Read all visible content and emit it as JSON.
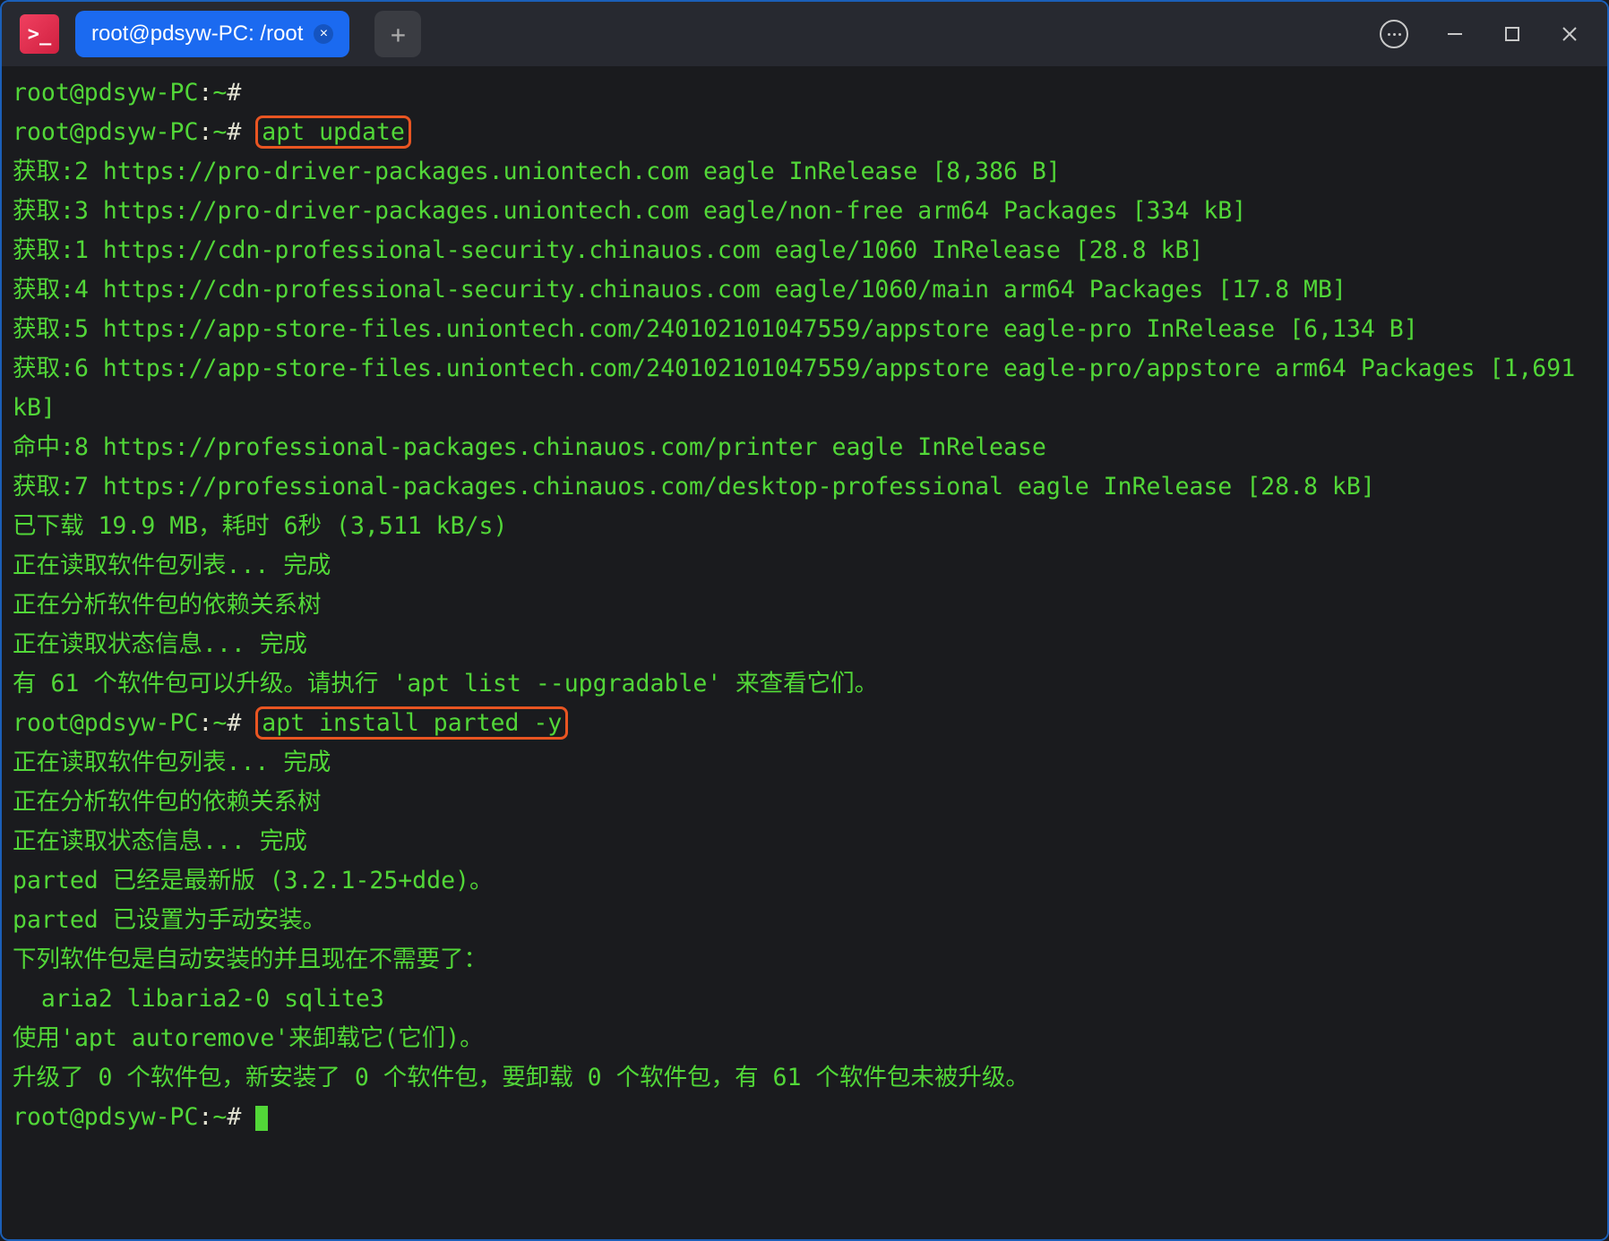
{
  "tab": {
    "title": "root@pdsyw-PC: /root"
  },
  "terminal": {
    "lines": [
      {
        "segments": [
          {
            "t": "root@pdsyw-PC",
            "c": "prompt-user"
          },
          {
            "t": ":",
            "c": "prompt-symbol"
          },
          {
            "t": "~",
            "c": "prompt-user"
          },
          {
            "t": "# ",
            "c": "prompt-symbol"
          }
        ]
      },
      {
        "segments": [
          {
            "t": "root@pdsyw-PC",
            "c": "prompt-user"
          },
          {
            "t": ":",
            "c": "prompt-symbol"
          },
          {
            "t": "~",
            "c": "prompt-user"
          },
          {
            "t": "# ",
            "c": "prompt-symbol"
          },
          {
            "t": "apt update",
            "c": "cmd-highlight",
            "name": "cmd-apt-update"
          }
        ]
      },
      {
        "segments": [
          {
            "t": "获取:2 https://pro-driver-packages.uniontech.com eagle InRelease [8,386 B]"
          }
        ]
      },
      {
        "segments": [
          {
            "t": "获取:3 https://pro-driver-packages.uniontech.com eagle/non-free arm64 Packages [334 kB]"
          }
        ]
      },
      {
        "segments": [
          {
            "t": "获取:1 https://cdn-professional-security.chinauos.com eagle/1060 InRelease [28.8 kB]"
          }
        ]
      },
      {
        "segments": [
          {
            "t": "获取:4 https://cdn-professional-security.chinauos.com eagle/1060/main arm64 Packages [17.8 MB]"
          }
        ]
      },
      {
        "segments": [
          {
            "t": "获取:5 https://app-store-files.uniontech.com/240102101047559/appstore eagle-pro InRelease [6,134 B]"
          }
        ]
      },
      {
        "segments": [
          {
            "t": "获取:6 https://app-store-files.uniontech.com/240102101047559/appstore eagle-pro/appstore arm64 Packages [1,691 kB]"
          }
        ]
      },
      {
        "segments": [
          {
            "t": "命中:8 https://professional-packages.chinauos.com/printer eagle InRelease"
          }
        ]
      },
      {
        "segments": [
          {
            "t": "获取:7 https://professional-packages.chinauos.com/desktop-professional eagle InRelease [28.8 kB]"
          }
        ]
      },
      {
        "segments": [
          {
            "t": "已下载 19.9 MB，耗时 6秒 (3,511 kB/s)"
          }
        ]
      },
      {
        "segments": [
          {
            "t": "正在读取软件包列表... 完成"
          }
        ]
      },
      {
        "segments": [
          {
            "t": "正在分析软件包的依赖关系树"
          }
        ]
      },
      {
        "segments": [
          {
            "t": "正在读取状态信息... 完成"
          }
        ]
      },
      {
        "segments": [
          {
            "t": "有 61 个软件包可以升级。请执行 'apt list --upgradable' 来查看它们。"
          }
        ]
      },
      {
        "segments": [
          {
            "t": "root@pdsyw-PC",
            "c": "prompt-user"
          },
          {
            "t": ":",
            "c": "prompt-symbol"
          },
          {
            "t": "~",
            "c": "prompt-user"
          },
          {
            "t": "# ",
            "c": "prompt-symbol"
          },
          {
            "t": "apt install parted -y",
            "c": "cmd-highlight",
            "name": "cmd-apt-install-parted"
          }
        ]
      },
      {
        "segments": [
          {
            "t": "正在读取软件包列表... 完成"
          }
        ]
      },
      {
        "segments": [
          {
            "t": "正在分析软件包的依赖关系树"
          }
        ]
      },
      {
        "segments": [
          {
            "t": "正在读取状态信息... 完成"
          }
        ]
      },
      {
        "segments": [
          {
            "t": "parted 已经是最新版 (3.2.1-25+dde)。"
          }
        ]
      },
      {
        "segments": [
          {
            "t": "parted 已设置为手动安装。"
          }
        ]
      },
      {
        "segments": [
          {
            "t": "下列软件包是自动安装的并且现在不需要了："
          }
        ]
      },
      {
        "segments": [
          {
            "t": "  aria2 libaria2-0 sqlite3"
          }
        ]
      },
      {
        "segments": [
          {
            "t": "使用'apt autoremove'来卸载它(它们)。"
          }
        ]
      },
      {
        "segments": [
          {
            "t": "升级了 0 个软件包，新安装了 0 个软件包，要卸载 0 个软件包，有 61 个软件包未被升级。"
          }
        ]
      },
      {
        "segments": [
          {
            "t": "root@pdsyw-PC",
            "c": "prompt-user"
          },
          {
            "t": ":",
            "c": "prompt-symbol"
          },
          {
            "t": "~",
            "c": "prompt-user"
          },
          {
            "t": "# ",
            "c": "prompt-symbol"
          }
        ],
        "cursor": true
      }
    ]
  }
}
